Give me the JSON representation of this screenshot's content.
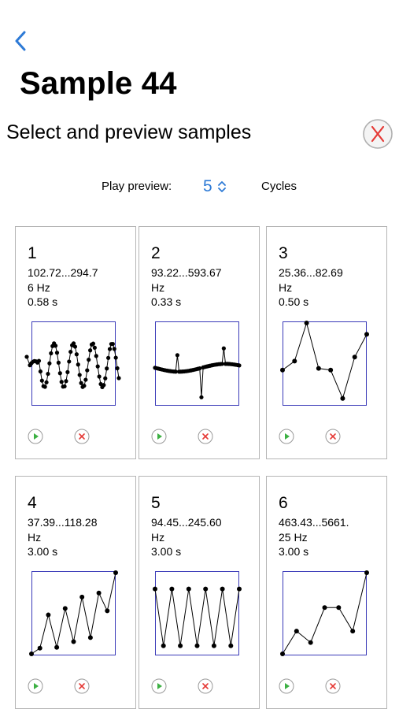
{
  "nav": {
    "back_icon": "chevron-left-icon",
    "accent": "#2d7ad6"
  },
  "header": {
    "title": "Sample 44",
    "subtitle": "Select and preview samples",
    "close_icon": "close-circle-icon",
    "close_color": "#e53935"
  },
  "preview": {
    "label": "Play preview:",
    "cycles": "5",
    "cycles_label": "Cycles",
    "stepper_icon": "chevron-up-down-icon"
  },
  "samples": [
    {
      "index": "1",
      "line1": "102.72...294.7",
      "line2": "6 Hz",
      "line3": "0.58 s"
    },
    {
      "index": "2",
      "line1": "93.22...593.67",
      "line2": "Hz",
      "line3": "0.33 s"
    },
    {
      "index": "3",
      "line1": "25.36...82.69",
      "line2": "Hz",
      "line3": "0.50 s"
    },
    {
      "index": "4",
      "line1": "37.39...118.28",
      "line2": "Hz",
      "line3": "3.00 s"
    },
    {
      "index": "5",
      "line1": "94.45...245.60",
      "line2": "Hz",
      "line3": "3.00 s"
    },
    {
      "index": "6",
      "line1": "463.43...5661.",
      "line2": "25 Hz",
      "line3": "3.00 s"
    }
  ],
  "waveforms": [
    {
      "kind": "dense-sine"
    },
    {
      "kind": "flat-spikes"
    },
    {
      "kind": "points",
      "y": [
        0.42,
        0.53,
        1.0,
        0.44,
        0.42,
        0.07,
        0.58,
        0.86
      ]
    },
    {
      "kind": "points",
      "y": [
        0.0,
        0.07,
        0.48,
        0.08,
        0.56,
        0.15,
        0.7,
        0.2,
        0.75,
        0.53,
        1.0
      ]
    },
    {
      "kind": "points",
      "y": [
        0.8,
        0.1,
        0.8,
        0.1,
        0.8,
        0.1,
        0.8,
        0.1,
        0.8,
        0.1,
        0.8
      ]
    },
    {
      "kind": "points",
      "y": [
        0.0,
        0.28,
        0.14,
        0.57,
        0.57,
        0.28,
        1.0
      ]
    }
  ],
  "colors": {
    "plot_border": "#3a3ab8",
    "play": "#3cb043",
    "delete": "#e53935",
    "card_border": "#b5b5b5"
  },
  "icons": {
    "play": "play-circle-icon",
    "delete": "delete-circle-icon"
  }
}
